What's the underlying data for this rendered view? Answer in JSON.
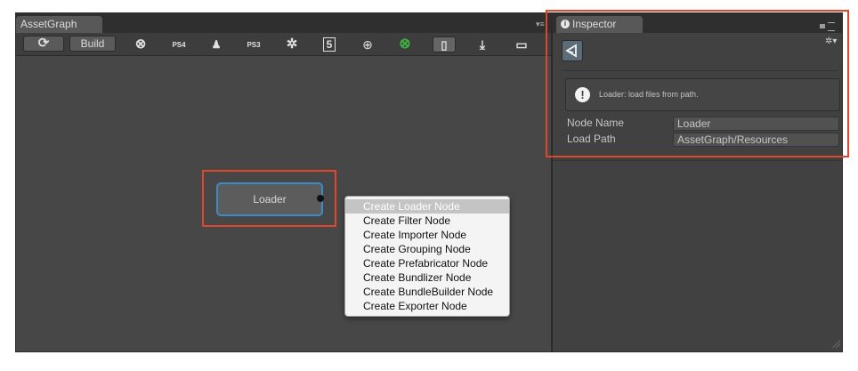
{
  "graph": {
    "tab_label": "AssetGraph",
    "menu_glyph": "▾≡",
    "refresh_glyph": "⟳",
    "build_label": "Build",
    "platforms": [
      {
        "icon": "xbox360-icon",
        "glyph": "⊗"
      },
      {
        "icon": "ps4-icon",
        "glyph": "PS4"
      },
      {
        "icon": "android-icon",
        "glyph": "♟"
      },
      {
        "icon": "ps3-icon",
        "glyph": "PS3"
      },
      {
        "icon": "unity-icon",
        "glyph": "✲"
      },
      {
        "icon": "html5-icon",
        "glyph": "5"
      },
      {
        "icon": "web-icon",
        "glyph": "⊕"
      },
      {
        "icon": "xboxone-icon",
        "glyph": "⊗"
      },
      {
        "icon": "ios-icon",
        "glyph": "▯"
      },
      {
        "icon": "download-icon",
        "glyph": "⤓"
      },
      {
        "icon": "tv-icon",
        "glyph": "▭"
      }
    ],
    "node_label": "Loader",
    "context_menu": [
      "Create Loader Node",
      "Create Filter Node",
      "Create Importer Node",
      "Create Grouping Node",
      "Create Prefabricator Node",
      "Create Bundlizer Node",
      "Create BundleBuilder Node",
      "Create Exporter Node"
    ]
  },
  "inspector": {
    "tab_label": "Inspector",
    "info_glyph": "i",
    "gear_glyph": "✲▾",
    "help_text": "Loader: load files from path.",
    "node_name_label": "Node Name",
    "node_name_value": "Loader",
    "load_path_label": "Load Path",
    "load_path_value": "AssetGraph/Resources"
  },
  "colors": {
    "highlight_red": "#e0462c",
    "node_border": "#3c8ac8",
    "traffic_green": "#3fb33f",
    "traffic_yellow": "#f1b320",
    "traffic_red": "#e24c3c"
  }
}
